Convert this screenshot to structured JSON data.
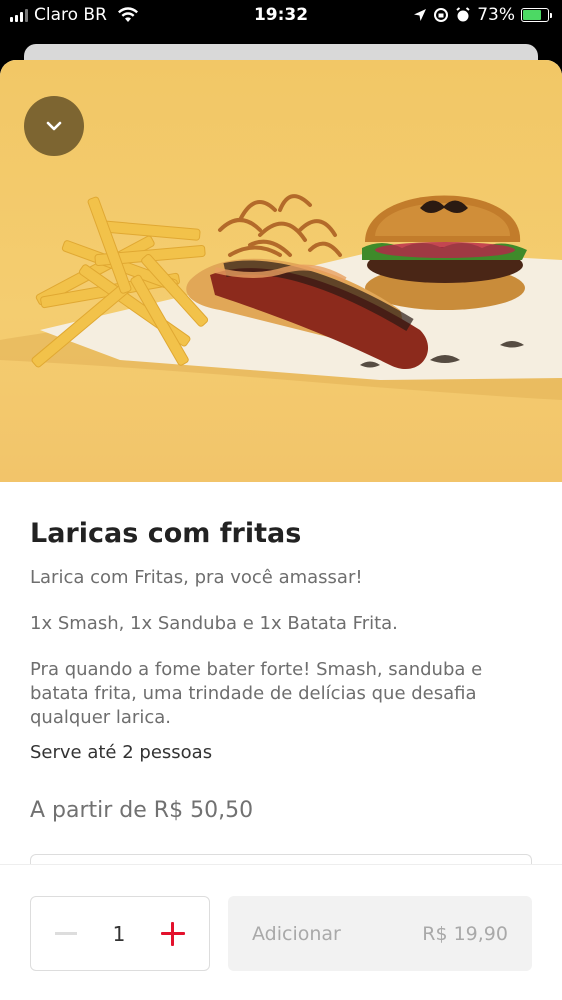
{
  "status_bar": {
    "carrier": "Claro BR",
    "time": "19:32",
    "battery": "73%",
    "battery_level": 0.73,
    "icons": [
      "signal-icon",
      "wifi-icon",
      "location-icon",
      "lock-rotation-icon",
      "alarm-icon",
      "battery-icon"
    ]
  },
  "product": {
    "close_icon": "chevron-down-icon",
    "title": "Laricas com fritas",
    "description_1": "Larica com Fritas, pra você amassar!",
    "description_2": "1x Smash, 1x Sanduba e 1x Batata Frita.",
    "description_3": "Pra quando a fome bater forte! Smash, sanduba e batata frita, uma trindade de delícias que desafia qualquer larica.",
    "serves": "Serve até 2 pessoas",
    "price_from": "A partir de R$ 50,50"
  },
  "footer": {
    "quantity": "1",
    "add_label": "Adicionar",
    "add_price": "R$ 19,90"
  },
  "colors": {
    "accent": "#e3112c",
    "hero_background": "#f4cd70",
    "close_button": "#7d6531"
  }
}
